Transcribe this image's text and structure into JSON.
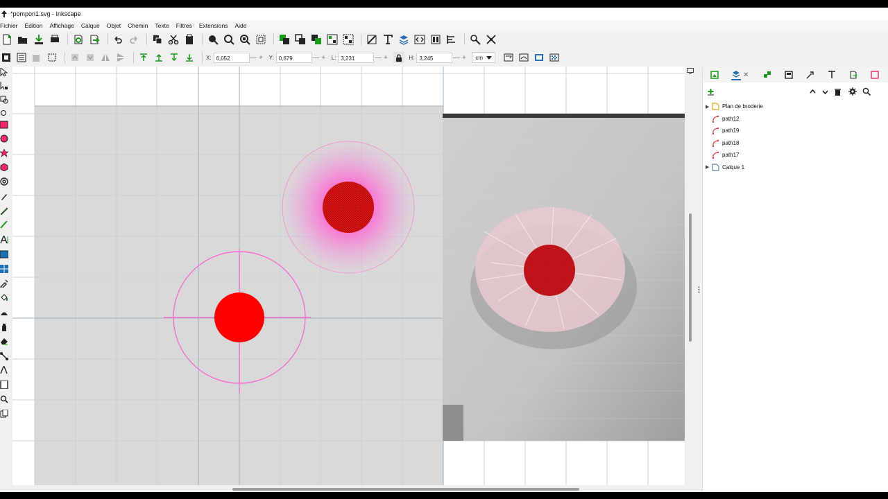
{
  "window": {
    "title": "*pompon1.svg - Inkscape"
  },
  "menu": [
    "Fichier",
    "Édition",
    "Affichage",
    "Calque",
    "Objet",
    "Chemin",
    "Texte",
    "Filtres",
    "Extensions",
    "Aide"
  ],
  "toolbar_icons": [
    "new-doc-icon",
    "open-icon",
    "save-icon",
    "print-icon",
    "import-icon",
    "export-icon",
    "undo-icon",
    "redo-icon",
    "copy-icon",
    "cut-icon",
    "paste-icon",
    "zoom-selection-icon",
    "zoom-drawing-icon",
    "zoom-page-icon",
    "zoom-fit-icon",
    "duplicate-icon",
    "clone-icon",
    "unlink-clone-icon",
    "group-icon",
    "ungroup-icon",
    "fill-stroke-icon",
    "text-font-icon",
    "layers-icon",
    "xml-editor-icon",
    "align-icon",
    "document-props-icon",
    "preferences-icon",
    "ungroup2-icon"
  ],
  "controls": {
    "x_label": "X:",
    "x_value": "6,052",
    "y_label": "Y:",
    "y_value": "0,679",
    "w_label": "L:",
    "w_value": "3,231",
    "h_label": "H:",
    "h_value": "3,245",
    "unit": "cm"
  },
  "layers_panel": {
    "items": [
      {
        "label": "Plan de broderie",
        "kind": "layer",
        "expandable": true
      },
      {
        "label": "path12",
        "kind": "path"
      },
      {
        "label": "path19",
        "kind": "path"
      },
      {
        "label": "path18",
        "kind": "path"
      },
      {
        "label": "path17",
        "kind": "path"
      },
      {
        "label": "Calque 1",
        "kind": "layer",
        "expandable": true
      }
    ]
  },
  "colors": {
    "pink": "#f472c8",
    "red": "#ff0000",
    "page": "#d9d9d9",
    "accent": "#2b6cb0"
  }
}
